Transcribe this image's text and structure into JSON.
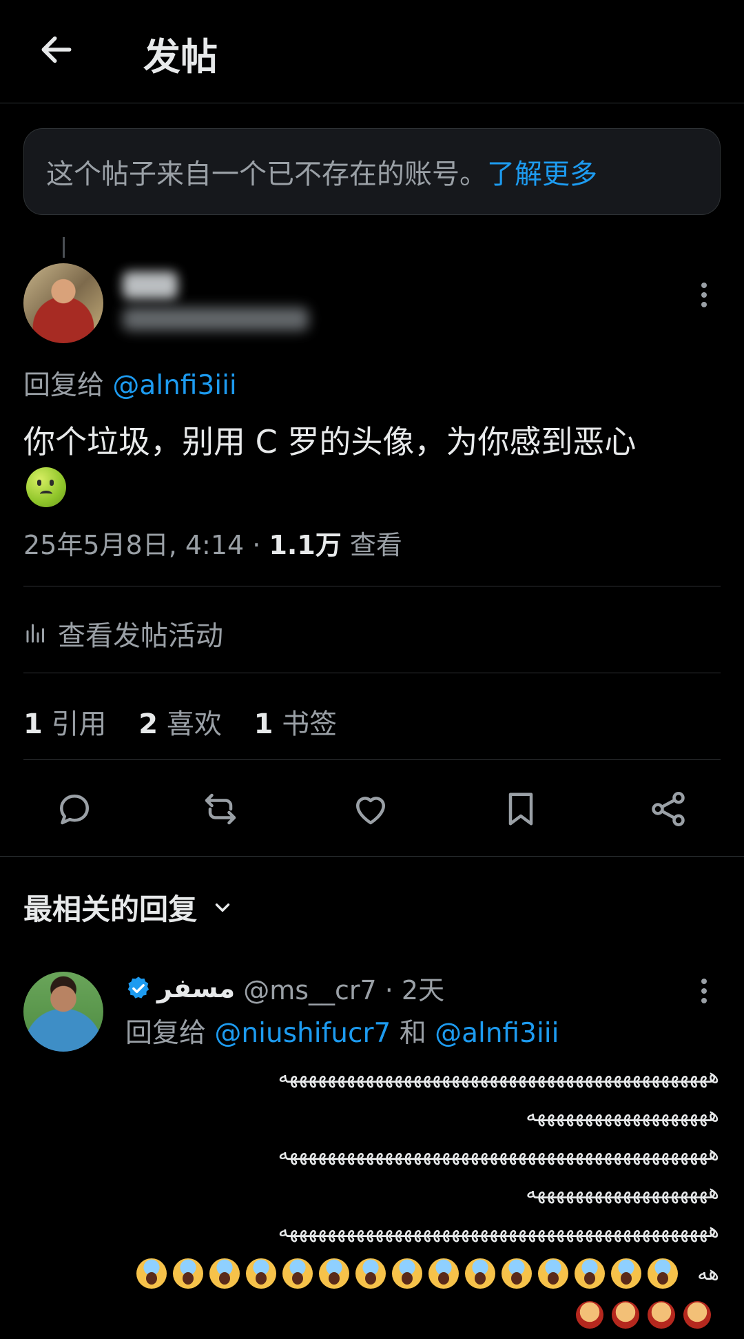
{
  "header": {
    "title": "发帖"
  },
  "notice": {
    "text": "这个帖子来自一个已不存在的账号。",
    "link": "了解更多"
  },
  "post": {
    "reply_prefix": "回复给",
    "reply_mention": "@alnfi3iii",
    "text": "你个垃圾，别用 C 罗的头像，为你感到恶心",
    "date": "25年5月8日, 4:14 · ",
    "views_count": "1.1万",
    "views_label": " 查看",
    "activity_label": "查看发帖活动",
    "stats": {
      "quotes_count": "1",
      "quotes_label": "引用",
      "likes_count": "2",
      "likes_label": "喜欢",
      "bookmarks_count": "1",
      "bookmarks_label": "书签"
    }
  },
  "replies_section": {
    "title": "最相关的回复"
  },
  "reply": {
    "name": "مسفر",
    "handle_time": "@ms__cr7 · 2天",
    "reply_prefix": "回复给",
    "mention1": "@niushifucr7",
    "and": " 和 ",
    "mention2": "@alnfi3iii",
    "line1": "هههههههههههههههههههههههههههههههههههههههههههههه",
    "line2": "هههههههههههههههههههه",
    "line3": "هههههههههههههههههههههههههههههههههههههههههههههه",
    "line4": "هههههههههههههههههههه",
    "line5": "هههههههههههههههههههههههههههههههههههههههههههههه",
    "line6": "هه"
  },
  "colors": {
    "accent": "#1d9bf0",
    "background": "#000000",
    "muted": "#9aa0a6"
  }
}
